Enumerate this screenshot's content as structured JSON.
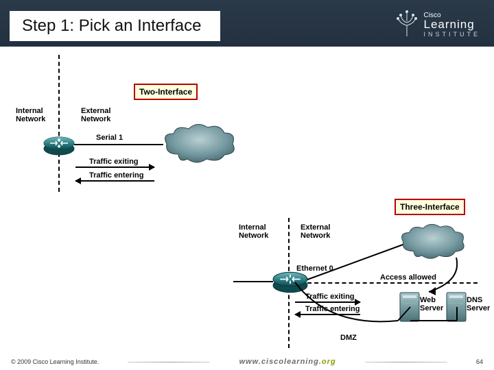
{
  "header": {
    "title": "Step 1: Pick an Interface",
    "brand_small": "Cisco",
    "brand_big": "Learning",
    "brand_sub": "INSTITUTE"
  },
  "labels": {
    "two_interface": "Two-Interface",
    "three_interface": "Three-Interface",
    "internal_network": "Internal\nNetwork",
    "external_network": "External\nNetwork",
    "serial1": "Serial 1",
    "internet": "Internet",
    "traffic_exiting": "Traffic exiting",
    "traffic_entering": "Traffic entering",
    "ethernet0": "Ethernet 0",
    "access_allowed": "Access allowed",
    "web_server": "Web\nServer",
    "dns_server": "DNS\nServer",
    "dmz": "DMZ"
  },
  "footer": {
    "copyright": "© 2009 Cisco Learning Institute.",
    "url_prefix": "www.",
    "url_main": "ciscolearning",
    "url_suffix": ".org",
    "page": "64"
  }
}
